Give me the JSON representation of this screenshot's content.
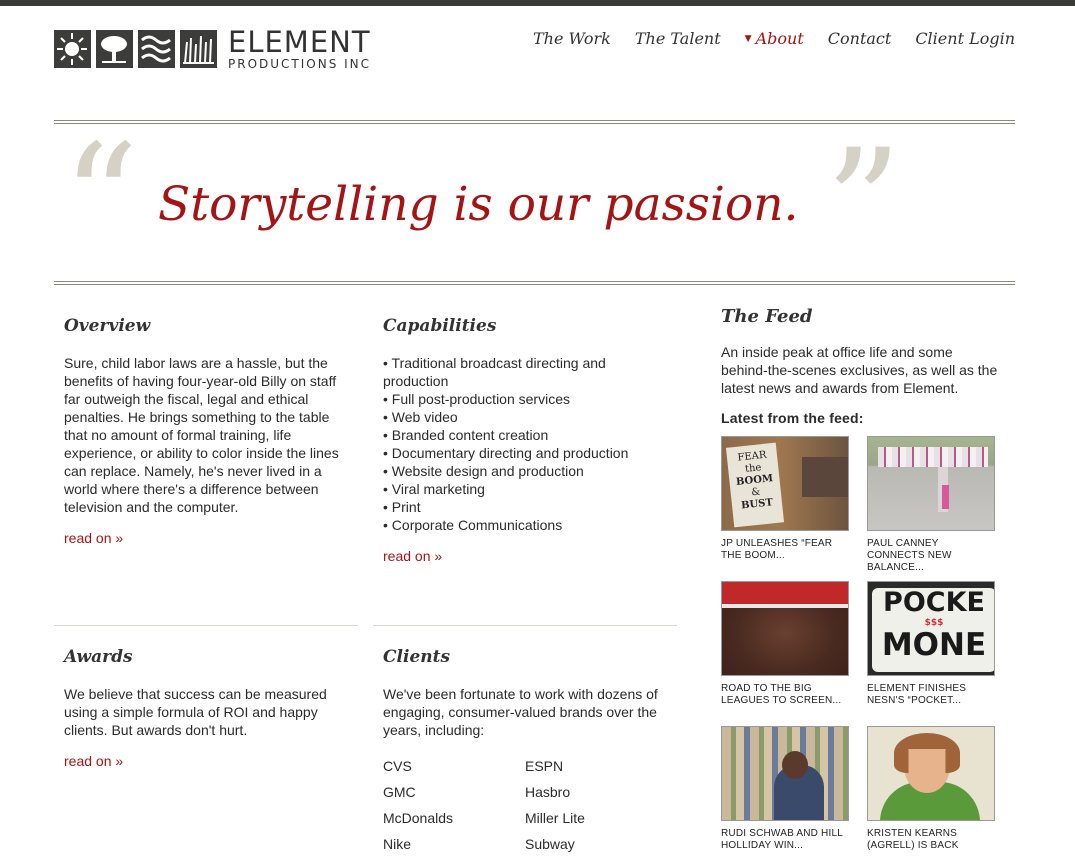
{
  "brand": {
    "name": "ELEMENT",
    "sub": "PRODUCTIONS INC"
  },
  "nav": [
    {
      "label": "The Work",
      "active": false
    },
    {
      "label": "The Talent",
      "active": false
    },
    {
      "label": "About",
      "active": true
    },
    {
      "label": "Contact",
      "active": false
    },
    {
      "label": "Client Login",
      "active": false
    }
  ],
  "hero": {
    "tagline": "Storytelling is our passion.",
    "open_quote": "“",
    "close_quote": "”"
  },
  "overview": {
    "title": "Overview",
    "body": "Sure, child labor laws are a hassle, but the benefits of having four-year-old Billy on staff far outweigh the fiscal, legal and ethical penalties. He brings something to the table that no amount of formal training, life experience, or ability to color inside the lines can replace. Namely, he's never lived in a world where there's a difference between television and the computer.",
    "read_more": "read on »"
  },
  "capabilities": {
    "title": "Capabilities",
    "items": [
      "Traditional broadcast directing and production",
      "Full post-production services",
      "Web video",
      "Branded content creation",
      "Documentary directing and production",
      "Website design and production",
      "Viral marketing",
      "Print",
      "Corporate Communications"
    ],
    "read_more": "read on »"
  },
  "awards": {
    "title": "Awards",
    "body": "We believe that success can be measured using a simple formula of ROI and happy clients. But awards don't hurt.",
    "read_more": "read on »"
  },
  "clients": {
    "title": "Clients",
    "intro": "We've been fortunate to work with dozens of engaging, consumer-valued brands over the years, including:",
    "list": [
      "CVS",
      "ESPN",
      "GMC",
      "Hasbro",
      "McDonalds",
      "Miller Lite",
      "Nike",
      "Subway"
    ]
  },
  "feed": {
    "title": "The Feed",
    "desc": "An inside peak at office life and some behind-the-scenes exclusives, as well as the latest news and awards from Element.",
    "latest": "Latest from the feed:",
    "items": [
      {
        "caption": "JP UNLEASHES “FEAR THE BOOM...",
        "sign1": "FEAR",
        "sign2": "the",
        "sign3": "BOOM",
        "sign4": "&",
        "sign5": "BUST"
      },
      {
        "caption": "PAUL CANNEY CONNECTS NEW BALANCE..."
      },
      {
        "caption": "ROAD TO THE BIG LEAGUES TO SCREEN..."
      },
      {
        "caption": "ELEMENT FINISHES NESN'S “POCKET...",
        "sign1": "POCKE",
        "sign2": "$$$",
        "sign3": "MONE"
      },
      {
        "caption": "RUDI SCHWAB AND HILL HOLLIDAY WIN..."
      },
      {
        "caption": "KRISTEN KEARNS (AGRELL) IS BACK"
      }
    ]
  },
  "colors": {
    "accent": "#a51414",
    "quote": "#d5d1c4",
    "text": "#2b2b2b"
  }
}
